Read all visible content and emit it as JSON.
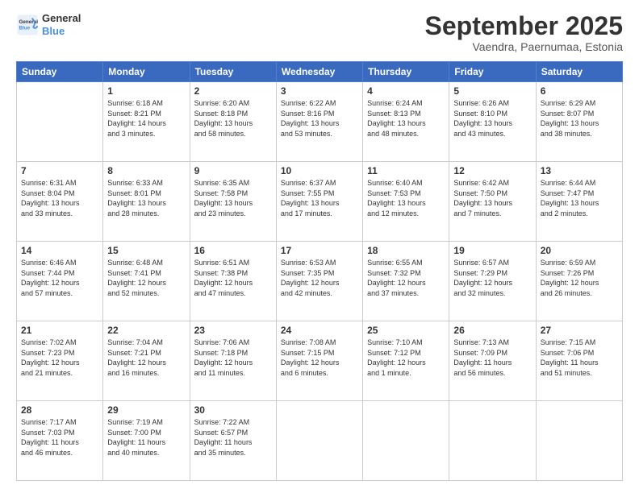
{
  "header": {
    "logo_line1": "General",
    "logo_line2": "Blue",
    "month": "September 2025",
    "location": "Vaendra, Paernumaa, Estonia"
  },
  "days_of_week": [
    "Sunday",
    "Monday",
    "Tuesday",
    "Wednesday",
    "Thursday",
    "Friday",
    "Saturday"
  ],
  "weeks": [
    [
      {
        "day": "",
        "info": ""
      },
      {
        "day": "1",
        "info": "Sunrise: 6:18 AM\nSunset: 8:21 PM\nDaylight: 14 hours\nand 3 minutes."
      },
      {
        "day": "2",
        "info": "Sunrise: 6:20 AM\nSunset: 8:18 PM\nDaylight: 13 hours\nand 58 minutes."
      },
      {
        "day": "3",
        "info": "Sunrise: 6:22 AM\nSunset: 8:16 PM\nDaylight: 13 hours\nand 53 minutes."
      },
      {
        "day": "4",
        "info": "Sunrise: 6:24 AM\nSunset: 8:13 PM\nDaylight: 13 hours\nand 48 minutes."
      },
      {
        "day": "5",
        "info": "Sunrise: 6:26 AM\nSunset: 8:10 PM\nDaylight: 13 hours\nand 43 minutes."
      },
      {
        "day": "6",
        "info": "Sunrise: 6:29 AM\nSunset: 8:07 PM\nDaylight: 13 hours\nand 38 minutes."
      }
    ],
    [
      {
        "day": "7",
        "info": "Sunrise: 6:31 AM\nSunset: 8:04 PM\nDaylight: 13 hours\nand 33 minutes."
      },
      {
        "day": "8",
        "info": "Sunrise: 6:33 AM\nSunset: 8:01 PM\nDaylight: 13 hours\nand 28 minutes."
      },
      {
        "day": "9",
        "info": "Sunrise: 6:35 AM\nSunset: 7:58 PM\nDaylight: 13 hours\nand 23 minutes."
      },
      {
        "day": "10",
        "info": "Sunrise: 6:37 AM\nSunset: 7:55 PM\nDaylight: 13 hours\nand 17 minutes."
      },
      {
        "day": "11",
        "info": "Sunrise: 6:40 AM\nSunset: 7:53 PM\nDaylight: 13 hours\nand 12 minutes."
      },
      {
        "day": "12",
        "info": "Sunrise: 6:42 AM\nSunset: 7:50 PM\nDaylight: 13 hours\nand 7 minutes."
      },
      {
        "day": "13",
        "info": "Sunrise: 6:44 AM\nSunset: 7:47 PM\nDaylight: 13 hours\nand 2 minutes."
      }
    ],
    [
      {
        "day": "14",
        "info": "Sunrise: 6:46 AM\nSunset: 7:44 PM\nDaylight: 12 hours\nand 57 minutes."
      },
      {
        "day": "15",
        "info": "Sunrise: 6:48 AM\nSunset: 7:41 PM\nDaylight: 12 hours\nand 52 minutes."
      },
      {
        "day": "16",
        "info": "Sunrise: 6:51 AM\nSunset: 7:38 PM\nDaylight: 12 hours\nand 47 minutes."
      },
      {
        "day": "17",
        "info": "Sunrise: 6:53 AM\nSunset: 7:35 PM\nDaylight: 12 hours\nand 42 minutes."
      },
      {
        "day": "18",
        "info": "Sunrise: 6:55 AM\nSunset: 7:32 PM\nDaylight: 12 hours\nand 37 minutes."
      },
      {
        "day": "19",
        "info": "Sunrise: 6:57 AM\nSunset: 7:29 PM\nDaylight: 12 hours\nand 32 minutes."
      },
      {
        "day": "20",
        "info": "Sunrise: 6:59 AM\nSunset: 7:26 PM\nDaylight: 12 hours\nand 26 minutes."
      }
    ],
    [
      {
        "day": "21",
        "info": "Sunrise: 7:02 AM\nSunset: 7:23 PM\nDaylight: 12 hours\nand 21 minutes."
      },
      {
        "day": "22",
        "info": "Sunrise: 7:04 AM\nSunset: 7:21 PM\nDaylight: 12 hours\nand 16 minutes."
      },
      {
        "day": "23",
        "info": "Sunrise: 7:06 AM\nSunset: 7:18 PM\nDaylight: 12 hours\nand 11 minutes."
      },
      {
        "day": "24",
        "info": "Sunrise: 7:08 AM\nSunset: 7:15 PM\nDaylight: 12 hours\nand 6 minutes."
      },
      {
        "day": "25",
        "info": "Sunrise: 7:10 AM\nSunset: 7:12 PM\nDaylight: 12 hours\nand 1 minute."
      },
      {
        "day": "26",
        "info": "Sunrise: 7:13 AM\nSunset: 7:09 PM\nDaylight: 11 hours\nand 56 minutes."
      },
      {
        "day": "27",
        "info": "Sunrise: 7:15 AM\nSunset: 7:06 PM\nDaylight: 11 hours\nand 51 minutes."
      }
    ],
    [
      {
        "day": "28",
        "info": "Sunrise: 7:17 AM\nSunset: 7:03 PM\nDaylight: 11 hours\nand 46 minutes."
      },
      {
        "day": "29",
        "info": "Sunrise: 7:19 AM\nSunset: 7:00 PM\nDaylight: 11 hours\nand 40 minutes."
      },
      {
        "day": "30",
        "info": "Sunrise: 7:22 AM\nSunset: 6:57 PM\nDaylight: 11 hours\nand 35 minutes."
      },
      {
        "day": "",
        "info": ""
      },
      {
        "day": "",
        "info": ""
      },
      {
        "day": "",
        "info": ""
      },
      {
        "day": "",
        "info": ""
      }
    ]
  ]
}
